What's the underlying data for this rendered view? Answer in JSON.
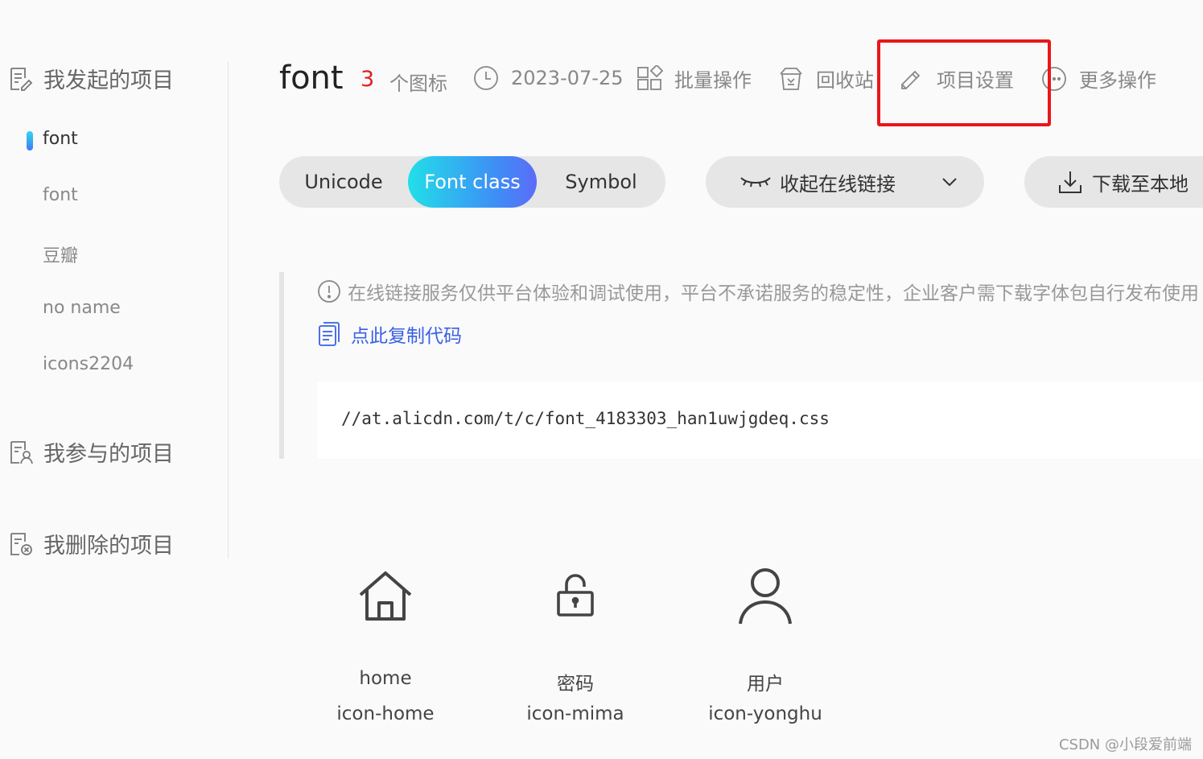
{
  "sidebar": {
    "groups": [
      {
        "label": "我发起的项目",
        "icon": "document-edit-icon"
      },
      {
        "label": "我参与的项目",
        "icon": "document-user-icon"
      },
      {
        "label": "我删除的项目",
        "icon": "document-delete-icon"
      }
    ],
    "projects": [
      {
        "label": "font",
        "active": true
      },
      {
        "label": "font"
      },
      {
        "label": "豆瓣"
      },
      {
        "label": "no name"
      },
      {
        "label": "icons2204"
      }
    ]
  },
  "header": {
    "title": "font",
    "icon_count": "3",
    "icon_count_label": "个图标",
    "date": "2023-07-25",
    "actions": {
      "batch": "批量操作",
      "recycle": "回收站",
      "settings": "项目设置",
      "more": "更多操作"
    }
  },
  "tabs": {
    "unicode": "Unicode",
    "font_class": "Font class",
    "symbol": "Symbol",
    "active": "Font class"
  },
  "toolbar": {
    "collapse_link": "收起在线链接",
    "download": "下载至本地"
  },
  "notice": {
    "text": "在线链接服务仅供平台体验和调试使用，平台不承诺服务的稳定性，企业客户需下载字体包自行发布使用",
    "copy": "点此复制代码"
  },
  "code": {
    "url": "//at.alicdn.com/t/c/font_4183303_han1uwjgdeq.css"
  },
  "icons": [
    {
      "name": "home",
      "class": "icon-home",
      "icon": "home-icon"
    },
    {
      "name": "密码",
      "class": "icon-mima",
      "icon": "lock-icon"
    },
    {
      "name": "用户",
      "class": "icon-yonghu",
      "icon": "user-icon"
    }
  ],
  "colors": {
    "accent_gradient_start": "#22dfe8",
    "accent_gradient_end": "#5c6cf7",
    "count_red": "#e02020",
    "link_blue": "#3a60e6",
    "highlight_red": "#e8171c"
  },
  "watermark": "CSDN @小段爱前端"
}
